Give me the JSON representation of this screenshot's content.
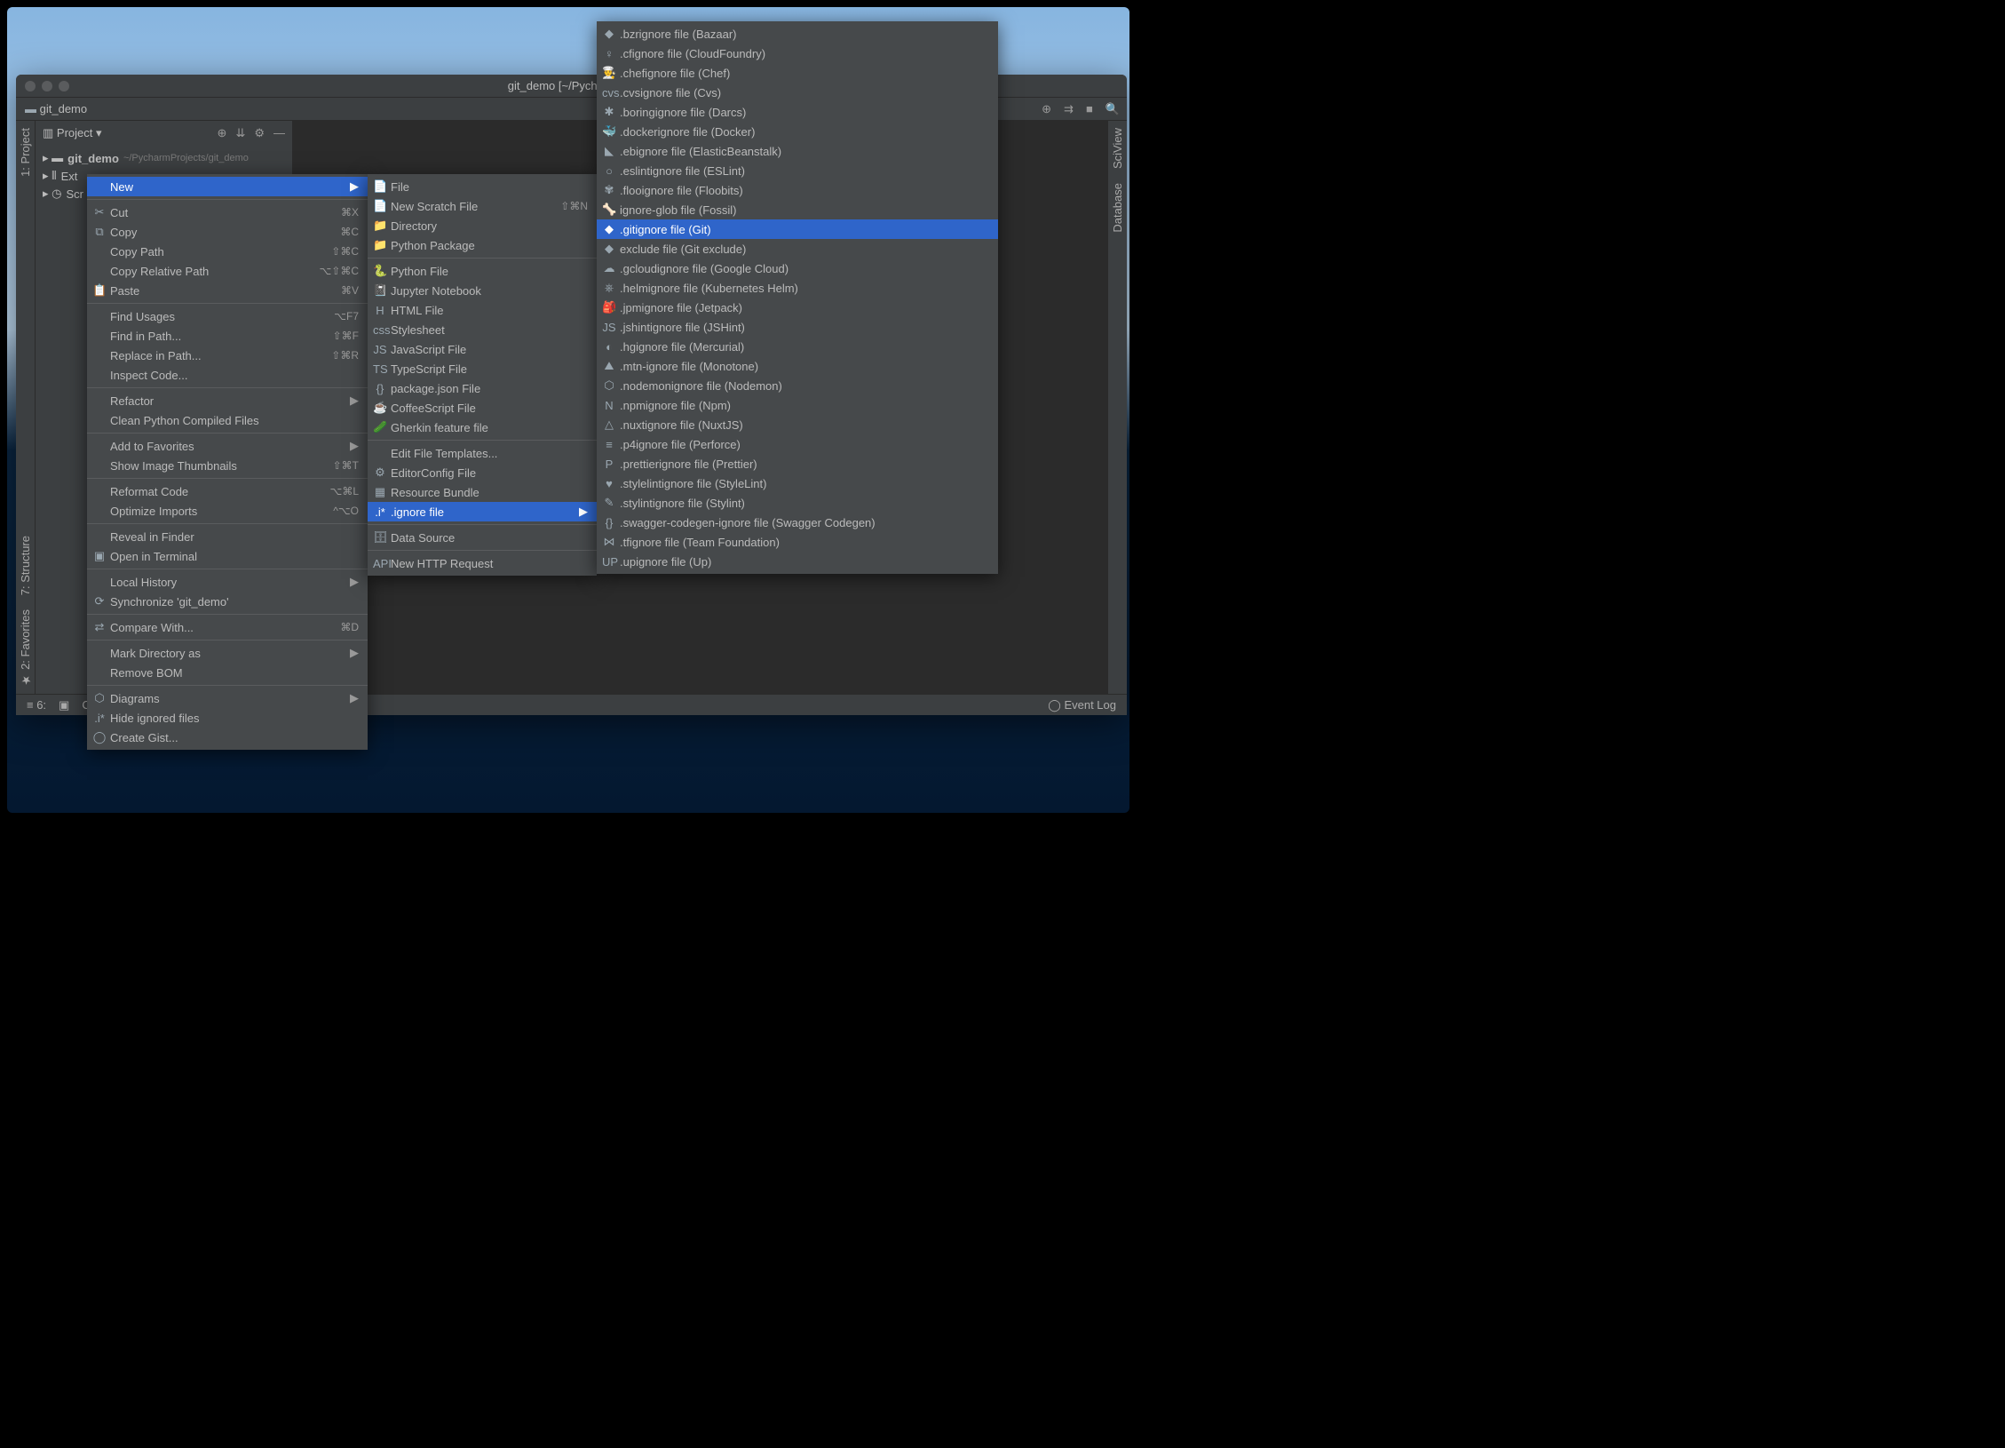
{
  "window": {
    "title": "git_demo [~/PycharmPro"
  },
  "breadcrumb": {
    "project": "git_demo"
  },
  "project_panel": {
    "label": "Project",
    "root": "git_demo",
    "root_path": "~/PycharmProjects/git_demo",
    "external": "Ext",
    "scratches": "Scr"
  },
  "left_rail": {
    "project": "1: Project",
    "structure": "7: Structure",
    "favorites": "2: Favorites"
  },
  "right_rail": {
    "sciview": "SciView",
    "database": "Database"
  },
  "status": {
    "todo": "6:",
    "create": "Create",
    "eventlog": "Event Log"
  },
  "context_menu": [
    {
      "label": "New",
      "submenu": true,
      "selected": true
    },
    {
      "sep": true
    },
    {
      "icon": "✂",
      "label": "Cut",
      "shortcut": "⌘X"
    },
    {
      "icon": "⧉",
      "label": "Copy",
      "shortcut": "⌘C"
    },
    {
      "label": "Copy Path",
      "shortcut": "⇧⌘C"
    },
    {
      "label": "Copy Relative Path",
      "shortcut": "⌥⇧⌘C"
    },
    {
      "icon": "📋",
      "label": "Paste",
      "shortcut": "⌘V"
    },
    {
      "sep": true
    },
    {
      "label": "Find Usages",
      "shortcut": "⌥F7"
    },
    {
      "label": "Find in Path...",
      "shortcut": "⇧⌘F"
    },
    {
      "label": "Replace in Path...",
      "shortcut": "⇧⌘R"
    },
    {
      "label": "Inspect Code..."
    },
    {
      "sep": true
    },
    {
      "label": "Refactor",
      "submenu": true
    },
    {
      "label": "Clean Python Compiled Files"
    },
    {
      "sep": true
    },
    {
      "label": "Add to Favorites",
      "submenu": true
    },
    {
      "label": "Show Image Thumbnails",
      "shortcut": "⇧⌘T"
    },
    {
      "sep": true
    },
    {
      "label": "Reformat Code",
      "shortcut": "⌥⌘L"
    },
    {
      "label": "Optimize Imports",
      "shortcut": "^⌥O"
    },
    {
      "sep": true
    },
    {
      "label": "Reveal in Finder"
    },
    {
      "icon": "▣",
      "label": "Open in Terminal"
    },
    {
      "sep": true
    },
    {
      "label": "Local History",
      "submenu": true
    },
    {
      "icon": "⟳",
      "label": "Synchronize 'git_demo'"
    },
    {
      "sep": true
    },
    {
      "icon": "⇄",
      "label": "Compare With...",
      "shortcut": "⌘D"
    },
    {
      "sep": true
    },
    {
      "label": "Mark Directory as",
      "submenu": true
    },
    {
      "label": "Remove BOM"
    },
    {
      "sep": true
    },
    {
      "icon": "⬡",
      "label": "Diagrams",
      "submenu": true
    },
    {
      "icon": ".i*",
      "label": "Hide ignored files"
    },
    {
      "icon": "◯",
      "label": "Create Gist..."
    }
  ],
  "new_menu": [
    {
      "icon": "📄",
      "label": "File"
    },
    {
      "icon": "📄",
      "label": "New Scratch File",
      "shortcut": "⇧⌘N"
    },
    {
      "icon": "📁",
      "label": "Directory"
    },
    {
      "icon": "📁",
      "label": "Python Package"
    },
    {
      "sep": true
    },
    {
      "icon": "🐍",
      "label": "Python File"
    },
    {
      "icon": "📓",
      "label": "Jupyter Notebook"
    },
    {
      "icon": "H",
      "label": "HTML File"
    },
    {
      "icon": "css",
      "label": "Stylesheet"
    },
    {
      "icon": "JS",
      "label": "JavaScript File"
    },
    {
      "icon": "TS",
      "label": "TypeScript File"
    },
    {
      "icon": "{}",
      "label": "package.json File"
    },
    {
      "icon": "☕",
      "label": "CoffeeScript File"
    },
    {
      "icon": "🥒",
      "label": "Gherkin feature file"
    },
    {
      "sep": true
    },
    {
      "label": "Edit File Templates..."
    },
    {
      "icon": "⚙",
      "label": "EditorConfig File"
    },
    {
      "icon": "▦",
      "label": "Resource Bundle"
    },
    {
      "icon": ".i*",
      "label": ".ignore file",
      "submenu": true,
      "selected": true
    },
    {
      "sep": true
    },
    {
      "icon": "🗄",
      "label": "Data Source"
    },
    {
      "sep": true
    },
    {
      "icon": "API",
      "label": "New HTTP Request"
    }
  ],
  "ignore_menu": [
    {
      "icon": "◆",
      "label": ".bzrignore file (Bazaar)"
    },
    {
      "icon": "♀",
      "label": ".cfignore file (CloudFoundry)"
    },
    {
      "icon": "👨‍🍳",
      "label": ".chefignore file (Chef)"
    },
    {
      "icon": "cvs",
      "label": ".cvsignore file (Cvs)"
    },
    {
      "icon": "✱",
      "label": ".boringignore file (Darcs)"
    },
    {
      "icon": "🐳",
      "label": ".dockerignore file (Docker)"
    },
    {
      "icon": "◣",
      "label": ".ebignore file (ElasticBeanstalk)"
    },
    {
      "icon": "○",
      "label": ".eslintignore file (ESLint)"
    },
    {
      "icon": "✾",
      "label": ".flooignore file (Floobits)"
    },
    {
      "icon": "🦴",
      "label": "ignore-glob file (Fossil)"
    },
    {
      "icon": "◆",
      "label": ".gitignore file (Git)",
      "selected": true
    },
    {
      "icon": "◆",
      "label": "exclude file (Git exclude)"
    },
    {
      "icon": "☁",
      "label": ".gcloudignore file (Google Cloud)"
    },
    {
      "icon": "⎈",
      "label": ".helmignore file (Kubernetes Helm)"
    },
    {
      "icon": "🎒",
      "label": ".jpmignore file (Jetpack)"
    },
    {
      "icon": "JS",
      "label": ".jshintignore file (JSHint)"
    },
    {
      "icon": "◐",
      "label": ".hgignore file (Mercurial)"
    },
    {
      "icon": "⛰",
      "label": ".mtn-ignore file (Monotone)"
    },
    {
      "icon": "⬡",
      "label": ".nodemonignore file (Nodemon)"
    },
    {
      "icon": "N",
      "label": ".npmignore file (Npm)"
    },
    {
      "icon": "△",
      "label": ".nuxtignore file (NuxtJS)"
    },
    {
      "icon": "≡",
      "label": ".p4ignore file (Perforce)"
    },
    {
      "icon": "P",
      "label": ".prettierignore file (Prettier)"
    },
    {
      "icon": "♥",
      "label": ".stylelintignore file (StyleLint)"
    },
    {
      "icon": "✎",
      "label": ".stylintignore file (Stylint)"
    },
    {
      "icon": "{}",
      "label": ".swagger-codegen-ignore file (Swagger Codegen)"
    },
    {
      "icon": "⋈",
      "label": ".tfignore file (Team Foundation)"
    },
    {
      "icon": "UP",
      "label": ".upignore file (Up)"
    }
  ]
}
